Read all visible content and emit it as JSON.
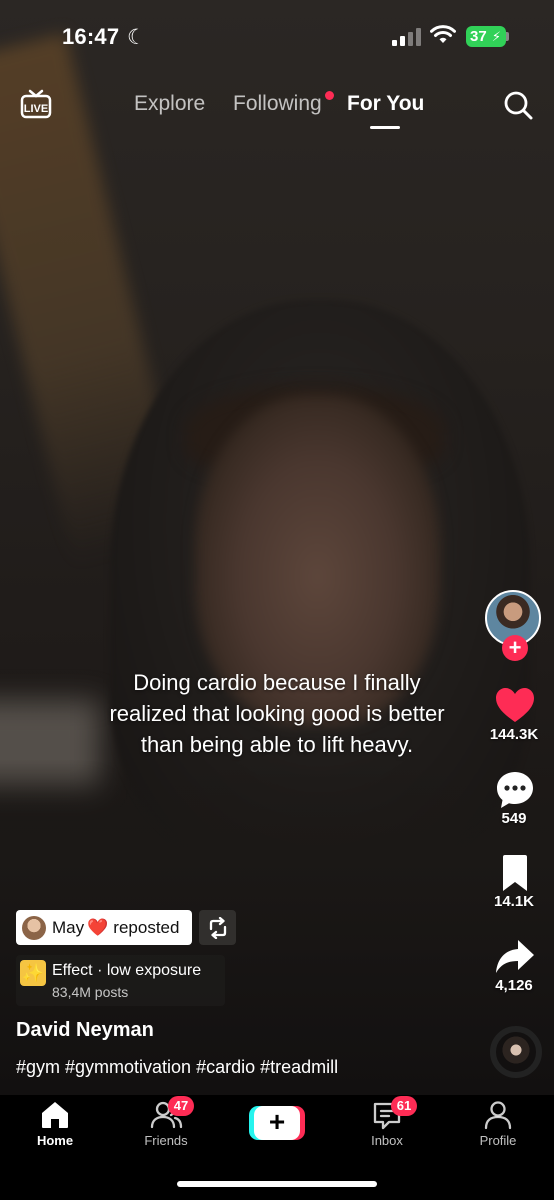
{
  "status_bar": {
    "time": "16:47",
    "battery": "37"
  },
  "top_nav": {
    "tabs": [
      {
        "label": "Explore"
      },
      {
        "label": "Following"
      },
      {
        "label": "For You"
      }
    ],
    "active_tab": "For You"
  },
  "video": {
    "caption": "Doing cardio because I finally realized that looking good is better than being able to lift heavy."
  },
  "actions": {
    "likes": "144.3K",
    "comments": "549",
    "saves": "14.1K",
    "shares": "4,126"
  },
  "repost": {
    "name": "May",
    "heart": "❤️",
    "label": "reposted"
  },
  "effect": {
    "title": "Effect · low exposure",
    "posts": "83,4M posts"
  },
  "author": {
    "name": "David Neyman"
  },
  "hashtags": "#gym #gymmotivation #cardio #treadmill",
  "bottom_nav": {
    "home": "Home",
    "friends": "Friends",
    "friends_badge": "47",
    "inbox": "Inbox",
    "inbox_badge": "61",
    "profile": "Profile"
  },
  "colors": {
    "accent": "#fe2c55",
    "cyan": "#25f4ee",
    "battery": "#31d158"
  }
}
